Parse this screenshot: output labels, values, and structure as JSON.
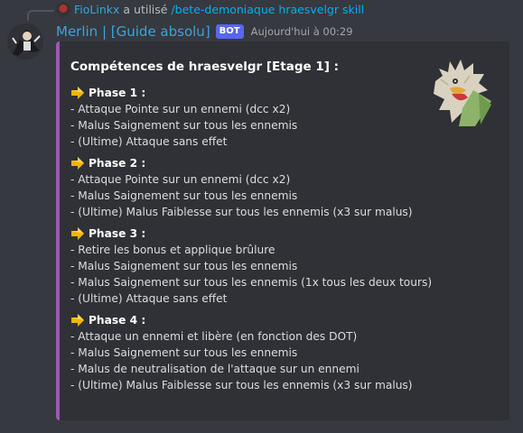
{
  "reply": {
    "user": "FioLinkx",
    "action": "a utilisé",
    "command": "/bete-demoniaque hraesvelgr skill"
  },
  "message": {
    "username": "Merlin | [Guide absolu]",
    "bot_tag": "BOT",
    "timestamp": "Aujourd'hui à 00:29"
  },
  "embed": {
    "accent_color": "#9b59b6",
    "title": "Compétences de hraesvelgr [Etage 1] :",
    "thumbnail_icon": "hraesvelgr-bird-icon",
    "phases": [
      {
        "title": "Phase 1 :",
        "lines": [
          "- Attaque Pointe sur un ennemi (dcc x2)",
          "- Malus Saignement sur tous les ennemis",
          "- (Ultime) Attaque sans effet"
        ]
      },
      {
        "title": "Phase 2 :",
        "lines": [
          "- Attaque Pointe sur un ennemi (dcc x2)",
          "- Malus Saignement sur tous les ennemis",
          "- (Ultime) Malus Faiblesse sur tous les ennemis (x3 sur malus)"
        ]
      },
      {
        "title": "Phase 3 :",
        "lines": [
          "- Retire les bonus et applique brûlure",
          "- Malus Saignement sur tous les ennemis",
          "- Malus Saignement sur tous les ennemis (1x tous les deux tours)",
          "- (Ultime) Attaque sans effet"
        ]
      },
      {
        "title": "Phase 4 :",
        "lines": [
          "- Attaque un ennemi et libère (en fonction des DOT)",
          "- Malus Saignement sur tous les ennemis",
          "- Malus de neutralisation de l'attaque sur un ennemi",
          "- (Ultime) Malus Faiblesse sur tous les ennemis (x3 sur malus)"
        ]
      }
    ]
  }
}
